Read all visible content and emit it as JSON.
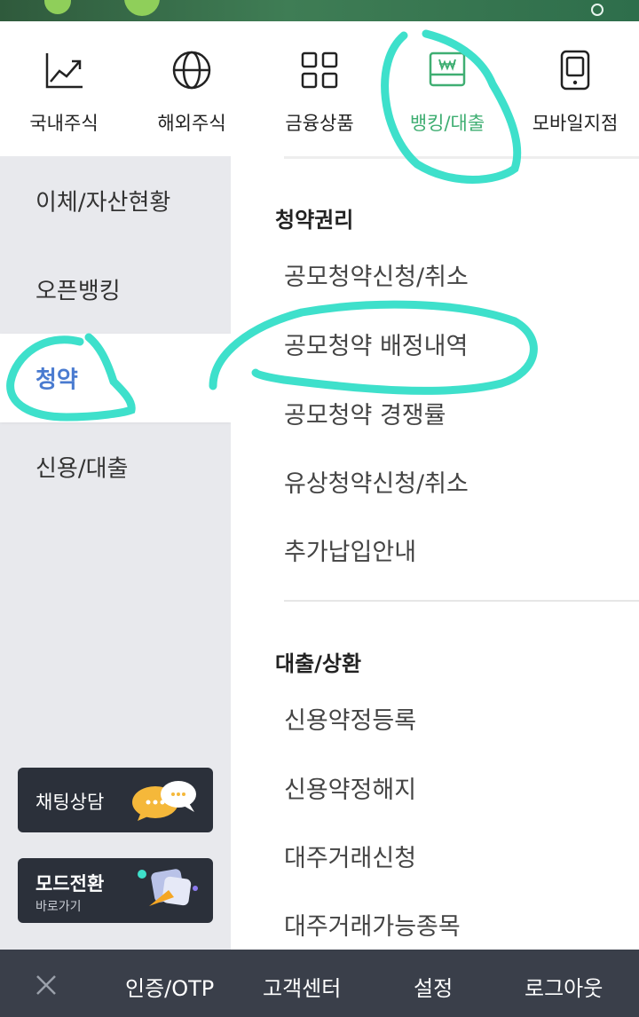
{
  "tabs": [
    {
      "label": "국내주식",
      "icon": "chart-line-icon"
    },
    {
      "label": "해외주식",
      "icon": "globe-icon"
    },
    {
      "label": "금융상품",
      "icon": "grid-icon"
    },
    {
      "label": "뱅킹/대출",
      "icon": "banknote-icon"
    },
    {
      "label": "모바일지점",
      "icon": "mobile-icon"
    }
  ],
  "sidebar": {
    "items": [
      {
        "label": "이체/자산현황"
      },
      {
        "label": "오픈뱅킹"
      },
      {
        "label": "청약"
      },
      {
        "label": "신용/대출"
      }
    ],
    "chat_label": "채팅상담",
    "mode_title": "모드전환",
    "mode_subtitle": "바로가기"
  },
  "main": {
    "sections": [
      {
        "title": "청약권리",
        "links": [
          "공모청약신청/취소",
          "공모청약 배정내역",
          "공모청약 경쟁률",
          "유상청약신청/취소",
          "추가납입안내"
        ]
      },
      {
        "title": "대출/상환",
        "links": [
          "신용약정등록",
          "신용약정해지",
          "대주거래신청",
          "대주거래가능종목"
        ]
      }
    ]
  },
  "bottom": {
    "items": [
      "인증/OTP",
      "고객센터",
      "설정",
      "로그아웃"
    ]
  },
  "colors": {
    "accent_green": "#3fae72",
    "active_blue": "#4a7bd0",
    "annotation": "#3ee0cb"
  }
}
